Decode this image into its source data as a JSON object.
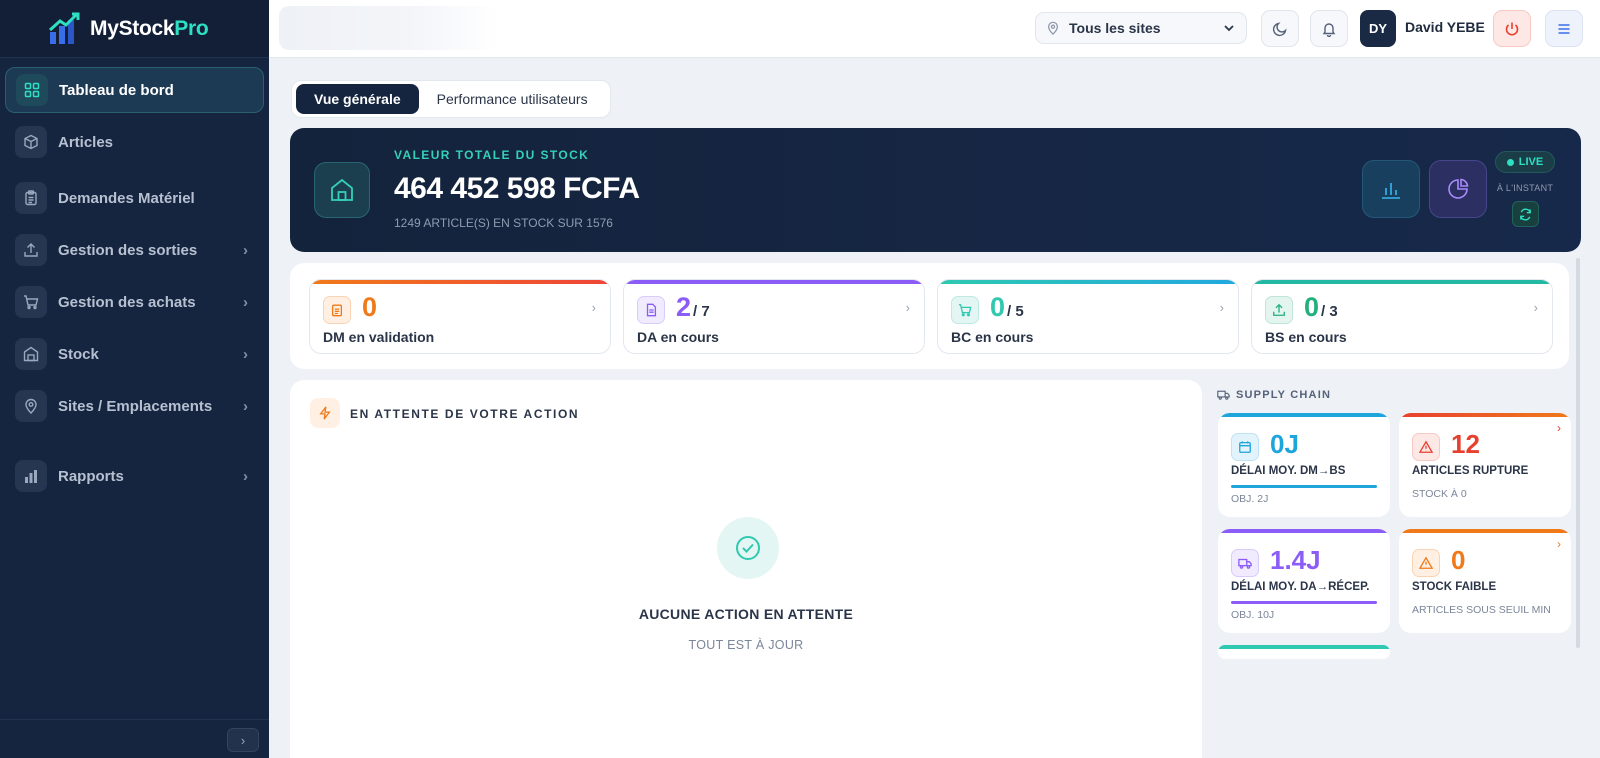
{
  "brand": {
    "name_main": "MyStock",
    "name_accent": "Pro"
  },
  "sidebar": {
    "items": [
      {
        "label": "Tableau de bord",
        "icon": "dashboard-icon",
        "active": true,
        "chevron": false
      },
      {
        "label": "Articles",
        "icon": "box-icon",
        "chevron": false
      },
      {
        "label": "Demandes Matériel",
        "icon": "clipboard-icon",
        "chevron": false
      },
      {
        "label": "Gestion des sorties",
        "icon": "upload-icon",
        "chevron": true
      },
      {
        "label": "Gestion des achats",
        "icon": "cart-icon",
        "chevron": true
      },
      {
        "label": "Stock",
        "icon": "warehouse-icon",
        "chevron": true
      },
      {
        "label": "Sites / Emplacements",
        "icon": "map-pin-icon",
        "chevron": true
      },
      {
        "label": "Rapports",
        "icon": "bar-chart-icon",
        "chevron": true
      }
    ]
  },
  "header": {
    "site_selector": "Tous les sites",
    "user_initials": "DY",
    "user_name": "David YEBE"
  },
  "tabs": [
    {
      "label": "Vue générale",
      "active": true
    },
    {
      "label": "Performance utilisateurs",
      "active": false
    }
  ],
  "hero": {
    "kicker": "VALEUR TOTALE DU STOCK",
    "value": "464 452 598 FCFA",
    "subtitle": "1249 ARTICLE(S) EN STOCK SUR 1576",
    "live_label": "LIVE",
    "updated": "À L'INSTANT"
  },
  "kpis": [
    {
      "value": "0",
      "total": "",
      "label": "DM en validation",
      "color": "#f07a1a",
      "bar": "linear-gradient(90deg,#f07a1a,#ef4438)",
      "icon_bg": "#fff0e3",
      "icon": "clipboard-icon"
    },
    {
      "value": "2",
      "total": "/ 7",
      "label": "DA en cours",
      "color": "#8b5cf6",
      "bar": "#8b5cf6",
      "icon_bg": "#f0ebfe",
      "icon": "document-icon"
    },
    {
      "value": "0",
      "total": "/ 5",
      "label": "BC en cours",
      "color": "#2ec9b0",
      "bar": "linear-gradient(90deg,#2ec9b0,#22a8e0)",
      "icon_bg": "#e4f6f3",
      "icon": "cart-icon"
    },
    {
      "value": "0",
      "total": "/ 3",
      "label": "BS en cours",
      "color": "#22b07d",
      "bar": "#22b8a4",
      "icon_bg": "#e3f5ee",
      "icon": "upload-icon"
    }
  ],
  "pending": {
    "title": "EN ATTENTE DE VOTRE ACTION",
    "empty_title": "AUCUNE ACTION EN ATTENTE",
    "empty_sub": "TOUT EST À JOUR"
  },
  "supply_chain": {
    "title": "SUPPLY CHAIN",
    "cards": [
      {
        "value": "0J",
        "label": "DÉLAI MOY. DM→BS",
        "sub": "OBJ. 2J",
        "color": "#1ea5dc",
        "icon": "calendar-icon",
        "icon_bg": "#e3f3fb",
        "progress": 1.0
      },
      {
        "value": "12",
        "label": "ARTICLES RUPTURE",
        "sub": "STOCK À 0",
        "color": "#e8402f",
        "icon": "alert-icon",
        "icon_bg": "#fde8e6",
        "progress": 0
      },
      {
        "value": "1.4J",
        "label": "DÉLAI MOY. DA→RÉCEP.",
        "sub": "OBJ. 10J",
        "color": "#8b5cf6",
        "icon": "truck-icon",
        "icon_bg": "#f0ebfe",
        "progress": 1.0
      },
      {
        "value": "0",
        "label": "STOCK FAIBLE",
        "sub": "ARTICLES SOUS SEUIL MIN",
        "color": "#f07a1a",
        "icon": "alert-icon",
        "icon_bg": "#fff0e3",
        "progress": 0
      }
    ]
  }
}
